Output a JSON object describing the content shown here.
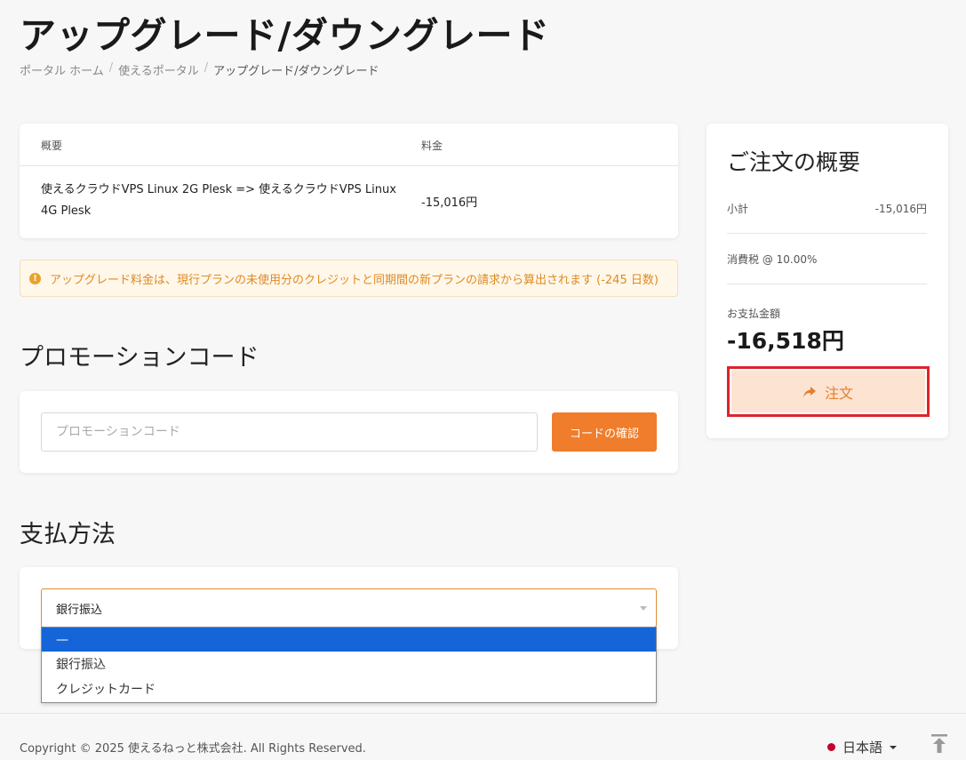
{
  "page": {
    "title": "アップグレード/ダウングレード"
  },
  "breadcrumb": [
    {
      "label": "ポータル ホーム"
    },
    {
      "label": "使えるポータル"
    },
    {
      "label": "アップグレード/ダウングレード"
    }
  ],
  "summary_table": {
    "columns": [
      "概要",
      "料金"
    ],
    "rows": [
      {
        "description": "使えるクラウドVPS Linux 2G Plesk => 使えるクラウドVPS Linux 4G Plesk",
        "price": "-15,016円"
      }
    ]
  },
  "alert": {
    "icon": "info-icon",
    "text": "アップグレード料金は、現行プランの未使用分のクレジットと同期間の新プランの請求から算出されます (-245 日数)"
  },
  "promo": {
    "heading": "プロモーションコード",
    "placeholder": "プロモーションコード",
    "button_label": "コードの確認"
  },
  "payment": {
    "heading": "支払方法",
    "selected": "銀行振込",
    "options": [
      "—",
      "銀行振込",
      "クレジットカード"
    ],
    "highlighted_option_index": 0
  },
  "order_summary": {
    "title": "ご注文の概要",
    "subtotal_label": "小計",
    "subtotal_value": "-15,016円",
    "tax_label": "消費税 @ 10.00%",
    "total_label": "お支払金額",
    "total_value": "-16,518円",
    "order_button_label": "注文",
    "order_button_icon": "share-arrow-icon"
  },
  "footer": {
    "copyright": "Copyright © 2025 使えるねっと株式会社. All Rights Reserved.",
    "language": "日本語"
  },
  "colors": {
    "accent": "#ef7d2b",
    "highlight_border": "#e0222a",
    "selected_option": "#1565d8"
  }
}
